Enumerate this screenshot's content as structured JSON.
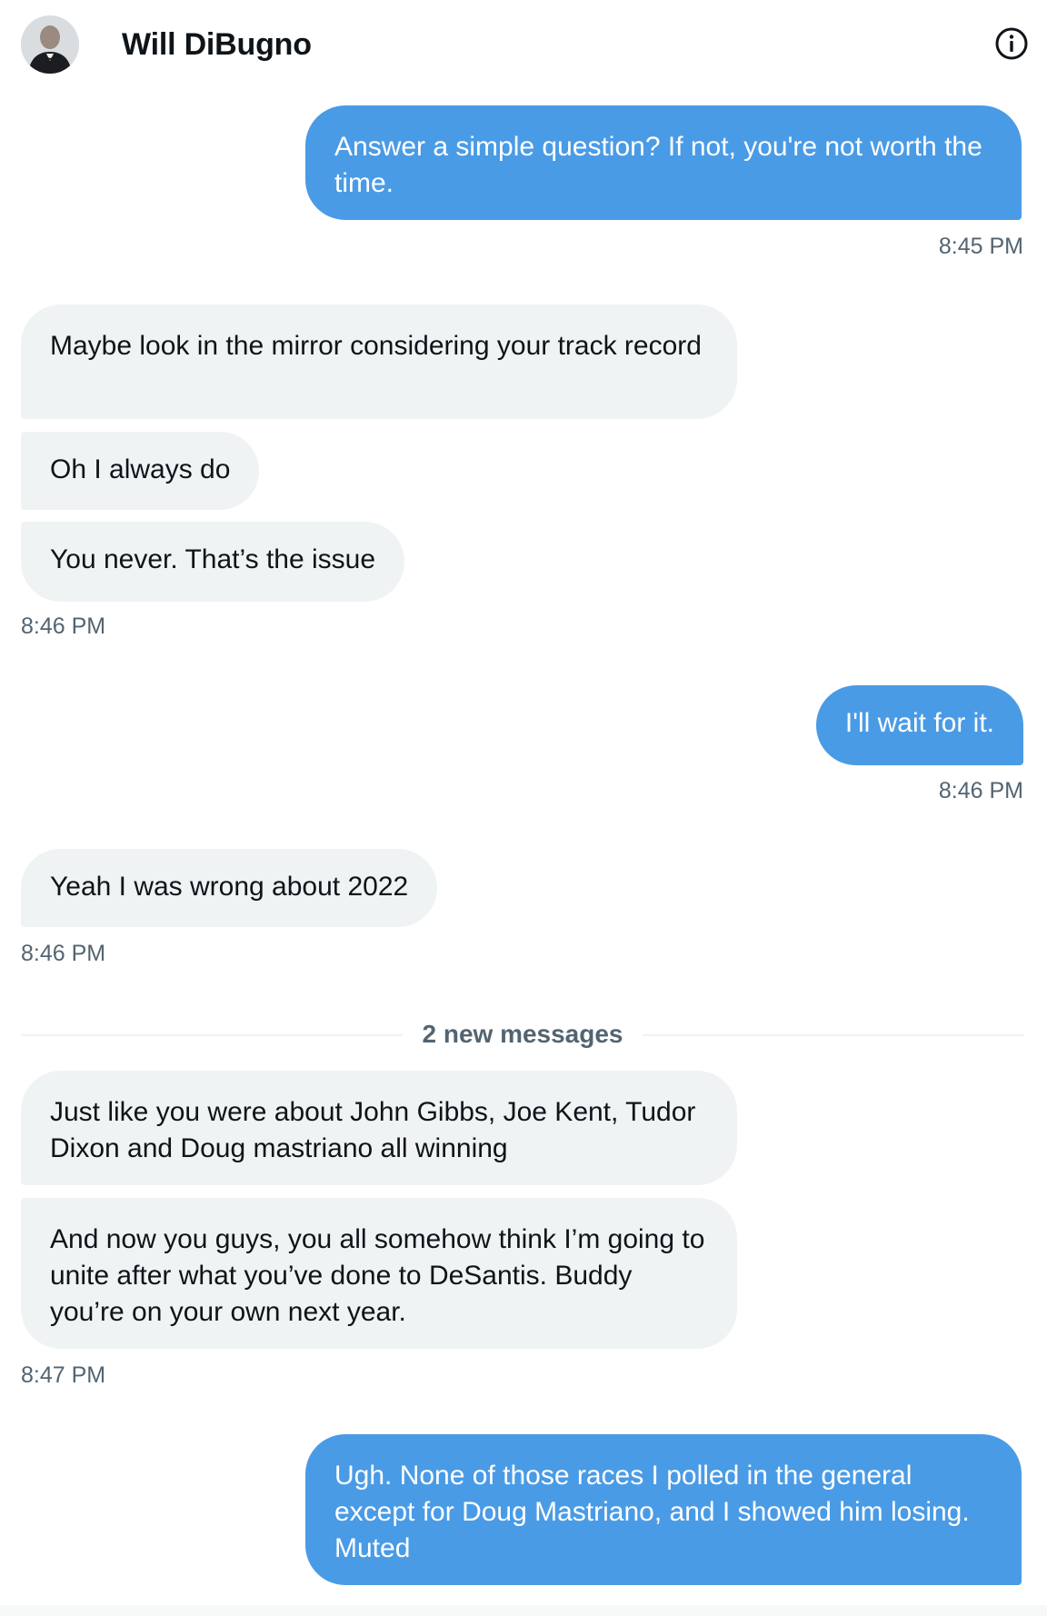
{
  "header": {
    "name": "Will DiBugno",
    "info_icon": "info-circle-icon",
    "avatar_icon": "avatar-photo"
  },
  "messages": [
    {
      "side": "sent",
      "text": "Answer a simple question? If not, you're not worth the time."
    },
    {
      "time": "8:45 PM"
    },
    {
      "side": "recv",
      "text": "Maybe look in the mirror considering your track record"
    },
    {
      "side": "recv",
      "text": "Oh I always do"
    },
    {
      "side": "recv",
      "text": "You never. That’s the issue"
    },
    {
      "time": "8:46 PM"
    },
    {
      "side": "sent",
      "text": "I'll wait for it."
    },
    {
      "time": "8:46 PM"
    },
    {
      "side": "recv",
      "text": "Yeah I was wrong about 2022"
    },
    {
      "time": "8:46 PM"
    },
    {
      "divider": "2 new messages"
    },
    {
      "side": "recv",
      "text": "Just like you were about John Gibbs, Joe Kent, Tudor Dixon and Doug mastriano all winning"
    },
    {
      "side": "recv",
      "text": "And now you guys, you all somehow think I’m going to unite after what you’ve done to DeSantis. Buddy you’re on your own next year."
    },
    {
      "time": "8:47 PM"
    },
    {
      "side": "sent",
      "text": "Ugh. None of those races I polled in the general except for Doug Mastriano, and I showed him losing. Muted"
    }
  ],
  "colors": {
    "sent_bubble": "#4a9be6",
    "recv_bubble": "#eff3f4",
    "timestamp": "#536471"
  }
}
